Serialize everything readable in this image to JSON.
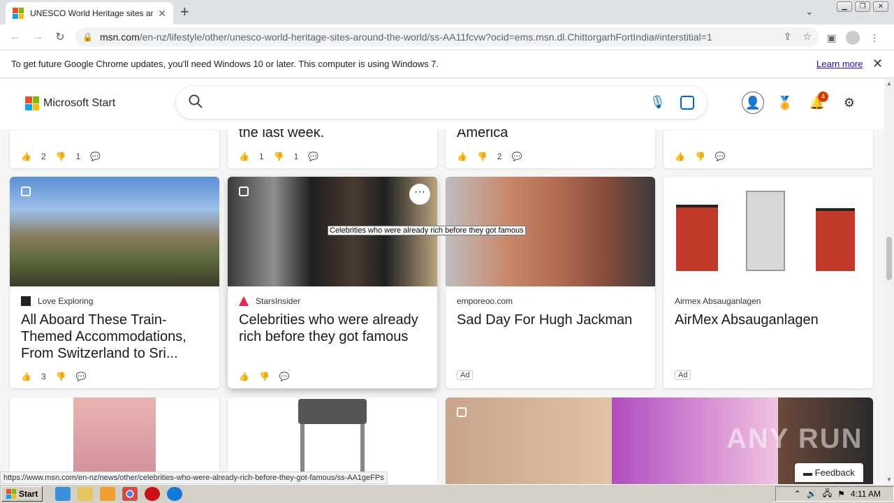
{
  "browser": {
    "tab_title": "UNESCO World Heritage sites around the world",
    "tab_close": "✕",
    "new_tab": "+",
    "url_host": "msn.com",
    "url_path": "/en-nz/lifestyle/other/unesco-world-heritage-sites-around-the-world/ss-AA11fcvw?ocid=ems.msn.dl.ChittorgarhFortIndia#interstitial=1",
    "window_buttons": [
      "▁",
      "❐",
      "✕"
    ]
  },
  "infobar": {
    "message": "To get future Google Chrome updates, you'll need Windows 10 or later. This computer is using Windows 7.",
    "learn_more": "Learn more",
    "close": "✕"
  },
  "msn": {
    "logo_text": "Microsoft Start",
    "notification_count": "4"
  },
  "top_row": [
    {
      "text": "",
      "likes": "2",
      "dislikes": "1"
    },
    {
      "text": "the last week.",
      "likes": "1",
      "dislikes": "1"
    },
    {
      "text": "America",
      "likes": "",
      "dislikes": "2"
    },
    {
      "text": "",
      "likes": "",
      "dislikes": ""
    }
  ],
  "cards": [
    {
      "source": "Love Exploring",
      "headline": "All Aboard These Train-Themed Accommodations, From Switzerland to Sri...",
      "likes": "3"
    },
    {
      "source": "StarsInsider",
      "headline": "Celebrities who were already rich before they got famous",
      "likes": ""
    },
    {
      "source": "emporeoo.com",
      "headline": "Sad Day For Hugh Jackman",
      "ad": "Ad"
    },
    {
      "source": "Airmex Absauganlagen",
      "headline": "AirMex Absauganlagen",
      "ad": "Ad"
    }
  ],
  "tooltip": "Celebrities who were already rich before they got famous",
  "status_url": "https://www.msn.com/en-nz/news/other/celebrities-who-were-already-rich-before-they-got-famous/ss-AA1geFPs",
  "feedback": "Feedback",
  "watermark": "ANY RUN",
  "taskbar": {
    "start": "Start",
    "clock": "4:11 AM"
  },
  "colors": {
    "accent": "#0067b8",
    "badge": "#d83b01"
  }
}
